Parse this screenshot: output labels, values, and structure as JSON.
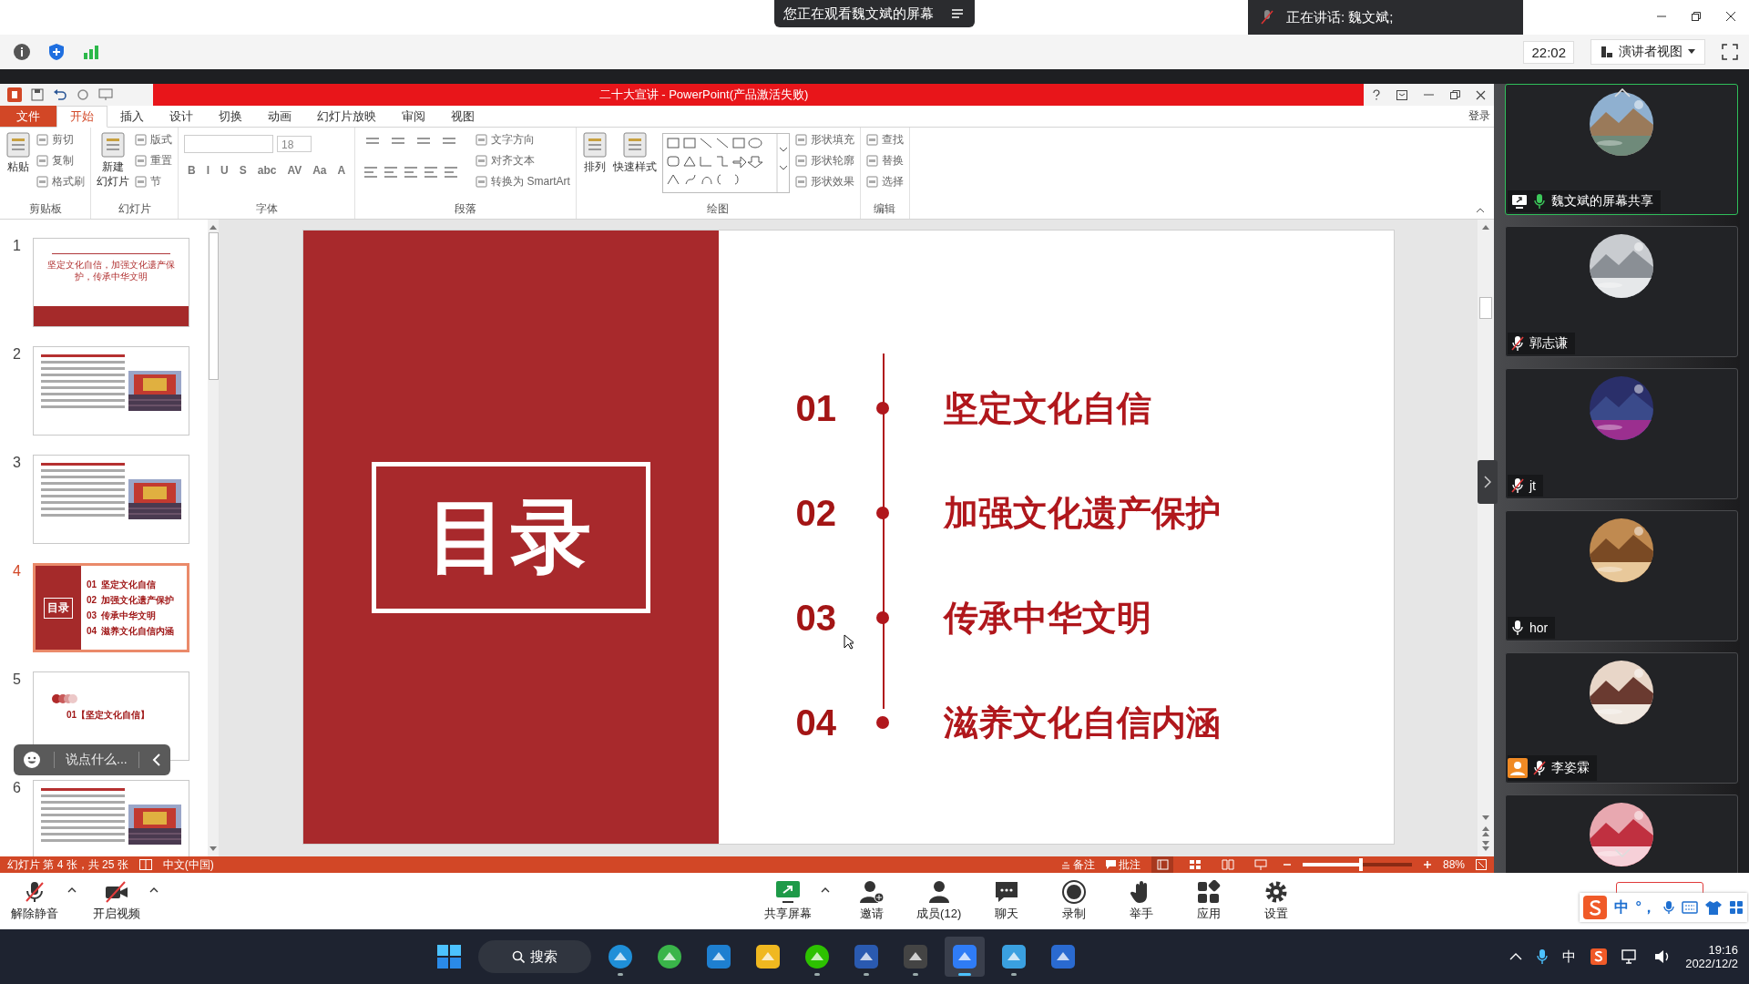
{
  "meeting": {
    "viewing_banner": "您正在观看魏文斌的屏幕",
    "speaking": "正在讲话: 魏文斌;",
    "timer": "22:02",
    "view_mode": "演讲者视图"
  },
  "ppt": {
    "title": "二十大宣讲 - PowerPoint(产品激活失败)",
    "login": "登录",
    "tabs": [
      {
        "label": "文件",
        "kind": "file",
        "selected": false
      },
      {
        "label": "开始",
        "kind": "tab",
        "selected": true
      },
      {
        "label": "插入",
        "kind": "tab",
        "selected": false
      },
      {
        "label": "设计",
        "kind": "tab",
        "selected": false
      },
      {
        "label": "切换",
        "kind": "tab",
        "selected": false
      },
      {
        "label": "动画",
        "kind": "tab",
        "selected": false
      },
      {
        "label": "幻灯片放映",
        "kind": "tab",
        "selected": false
      },
      {
        "label": "审阅",
        "kind": "tab",
        "selected": false
      },
      {
        "label": "视图",
        "kind": "tab",
        "selected": false
      }
    ],
    "ribbon": [
      {
        "label": "剪贴板",
        "kind": "plain",
        "large": [
          [
            "粘贴"
          ]
        ],
        "small": [
          "剪切",
          "复制",
          "格式刷"
        ]
      },
      {
        "label": "幻灯片",
        "kind": "plain",
        "large": [
          [
            "新建",
            "幻灯片"
          ]
        ],
        "small": [
          "版式",
          "重置",
          "节"
        ]
      },
      {
        "label": "字体",
        "kind": "font",
        "size": "18",
        "format": [
          "B",
          "I",
          "U",
          "S",
          "abc",
          "AV",
          "Aa",
          "A"
        ]
      },
      {
        "label": "段落",
        "kind": "paragraph",
        "small": [
          "文字方向",
          "对齐文本",
          "转换为 SmartArt"
        ]
      },
      {
        "label": "绘图",
        "kind": "drawing",
        "large": [
          [
            "排列"
          ],
          [
            "快速样式"
          ]
        ],
        "small": [
          "形状填充",
          "形状轮廓",
          "形状效果"
        ]
      },
      {
        "label": "编辑",
        "kind": "plain",
        "small": [
          "查找",
          "替换",
          "选择"
        ]
      }
    ],
    "thumbnails": [
      {
        "number": "1",
        "selected": false,
        "kind": "title",
        "title": "坚定文化自信，加强文化遗产保护，传承中华文明"
      },
      {
        "number": "2",
        "selected": false,
        "kind": "text-photo"
      },
      {
        "number": "3",
        "selected": false,
        "kind": "text-photo"
      },
      {
        "number": "4",
        "selected": true,
        "kind": "toc",
        "heading": "目录",
        "items": [
          {
            "number": "01",
            "text": "坚定文化自信"
          },
          {
            "number": "02",
            "text": "加强文化遗产保护"
          },
          {
            "number": "03",
            "text": "传承中华文明"
          },
          {
            "number": "04",
            "text": "滋养文化自信内涵"
          }
        ]
      },
      {
        "number": "5",
        "selected": false,
        "kind": "section",
        "title": "01【坚定文化自信】"
      },
      {
        "number": "6",
        "selected": false,
        "kind": "text-photo"
      }
    ],
    "slide": {
      "heading": "目录",
      "items": [
        {
          "number": "01",
          "text": "坚定文化自信"
        },
        {
          "number": "02",
          "text": "加强文化遗产保护"
        },
        {
          "number": "03",
          "text": "传承中华文明"
        },
        {
          "number": "04",
          "text": "滋养文化自信内涵"
        }
      ]
    },
    "status": {
      "slide_info": "幻灯片 第 4 张，共 25 张",
      "language": "中文(中国)",
      "notes": "备注",
      "comments": "批注",
      "zoom": "88%",
      "zoom_slider": {
        "level": 0.55
      }
    }
  },
  "chat_input": {
    "placeholder": "说点什么..."
  },
  "participants": [
    {
      "name": "魏文斌的屏幕共享",
      "muted": false,
      "speaking": true,
      "sharing": true,
      "host": false,
      "selected": true
    },
    {
      "name": "郭志谦",
      "muted": true,
      "speaking": false,
      "sharing": false,
      "host": false,
      "selected": false
    },
    {
      "name": "jt",
      "muted": true,
      "speaking": false,
      "sharing": false,
      "host": false,
      "selected": false
    },
    {
      "name": "hor",
      "muted": false,
      "speaking": false,
      "sharing": false,
      "host": false,
      "selected": false
    },
    {
      "name": "李姿霖",
      "muted": true,
      "speaking": false,
      "sharing": false,
      "host": true,
      "selected": false
    },
    {
      "selected": false
    }
  ],
  "toolbar": [
    {
      "label": "解除静音",
      "kind": "mic",
      "caret": true
    },
    {
      "label": "开启视频",
      "kind": "video",
      "caret": true
    },
    {
      "label": "共享屏幕",
      "kind": "share",
      "caret": true
    },
    {
      "label": "邀请",
      "kind": "invite",
      "caret": false
    },
    {
      "label": "成员(12)",
      "kind": "members",
      "caret": false
    },
    {
      "label": "聊天",
      "kind": "chat",
      "caret": false
    },
    {
      "label": "录制",
      "kind": "record",
      "caret": false
    },
    {
      "label": "举手",
      "kind": "hand",
      "caret": false
    },
    {
      "label": "应用",
      "kind": "apps",
      "caret": false
    },
    {
      "label": "设置",
      "kind": "settings",
      "caret": false
    }
  ],
  "ime": [
    "中",
    "°，"
  ],
  "taskbar": {
    "search": "搜索",
    "apps": [
      {
        "kind": "windows",
        "running": false
      },
      {
        "kind": "edge",
        "running": true
      },
      {
        "kind": "browser",
        "running": false
      },
      {
        "kind": "mail",
        "running": false
      },
      {
        "kind": "folder",
        "running": false
      },
      {
        "kind": "wechat",
        "running": true
      },
      {
        "kind": "cards",
        "running": true
      },
      {
        "kind": "shield",
        "running": true
      },
      {
        "kind": "meeting",
        "running": true
      },
      {
        "kind": "paint",
        "running": true
      },
      {
        "kind": "sogou",
        "running": false
      }
    ],
    "input": "中",
    "time": "19:16",
    "date": "2022/12/2"
  }
}
